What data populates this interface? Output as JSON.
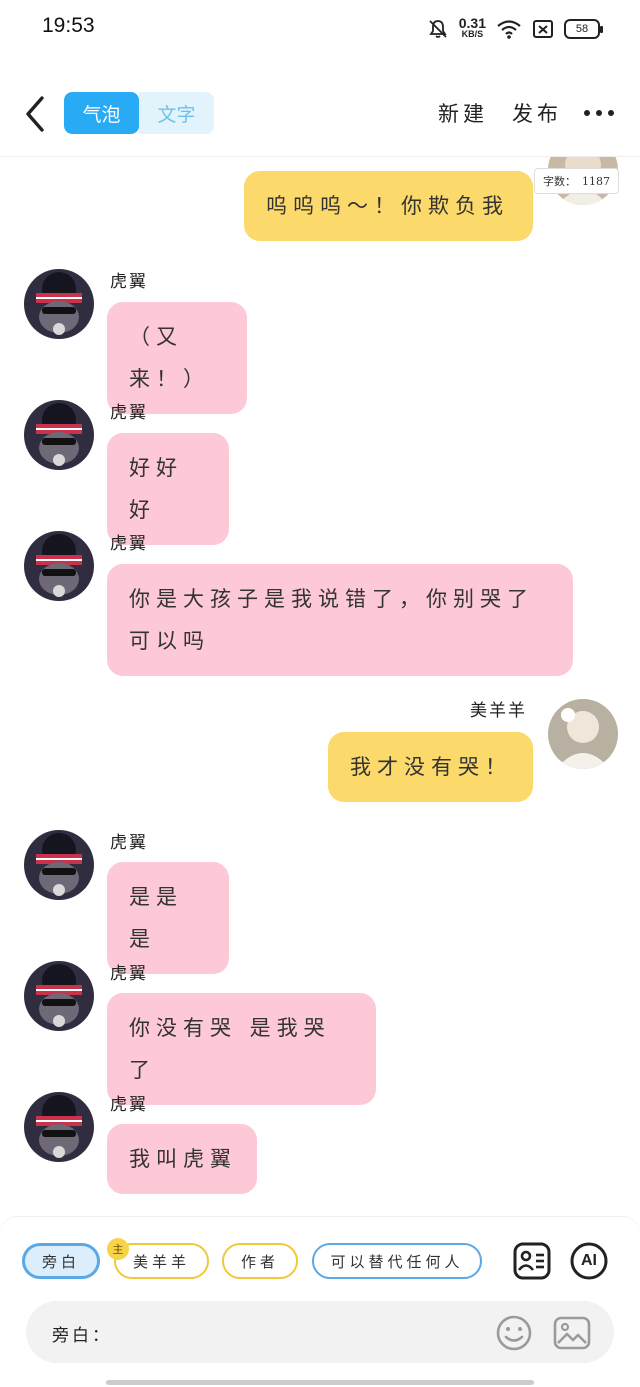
{
  "status": {
    "time": "19:53",
    "speed_value": "0.31",
    "speed_unit": "KB/S",
    "battery": "58"
  },
  "header": {
    "tab_bubble": "气泡",
    "tab_text": "文字",
    "new_label": "新建",
    "publish_label": "发布"
  },
  "word_count": {
    "label": "字数：",
    "value": "1187"
  },
  "messages": [
    {
      "side": "right",
      "name": "",
      "text": "呜呜呜～！你欺负我",
      "color": "#fbd96a"
    },
    {
      "side": "left",
      "name": "虎翼",
      "text": "（又来！）",
      "color": "#fec9d6"
    },
    {
      "side": "left",
      "name": "虎翼",
      "text": "好好好",
      "color": "#fec9d6"
    },
    {
      "side": "left",
      "name": "虎翼",
      "text_line1": "你是大孩子是我说错了，你别哭了",
      "text_line2": "可以吗",
      "color": "#fec9d6"
    },
    {
      "side": "right",
      "name": "美羊羊",
      "text": "我才没有哭！",
      "color": "#fbd96a"
    },
    {
      "side": "left",
      "name": "虎翼",
      "text": "是是是",
      "color": "#fec9d6"
    },
    {
      "side": "left",
      "name": "虎翼",
      "text": "你没有哭 是我哭了",
      "color": "#fec9d6"
    },
    {
      "side": "left",
      "name": "虎翼",
      "text": "我叫虎翼",
      "color": "#fec9d6"
    }
  ],
  "roles": {
    "narration": "旁白",
    "main_badge": "主",
    "meiyangyang": "美羊羊",
    "author": "作者",
    "anyone": "可以替代任何人",
    "ai_label": "AI"
  },
  "input": {
    "label": "旁白："
  },
  "icons": {
    "back": "chevron-left-icon",
    "more": "more-dots-icon",
    "contact": "contact-card-icon",
    "emoji": "emoji-icon",
    "image": "image-icon"
  },
  "colors": {
    "accent_blue": "#29aaf4",
    "bubble_pink": "#fec9d6",
    "bubble_yellow": "#fbd96a",
    "chip_yellow_border": "#f1c83a"
  }
}
